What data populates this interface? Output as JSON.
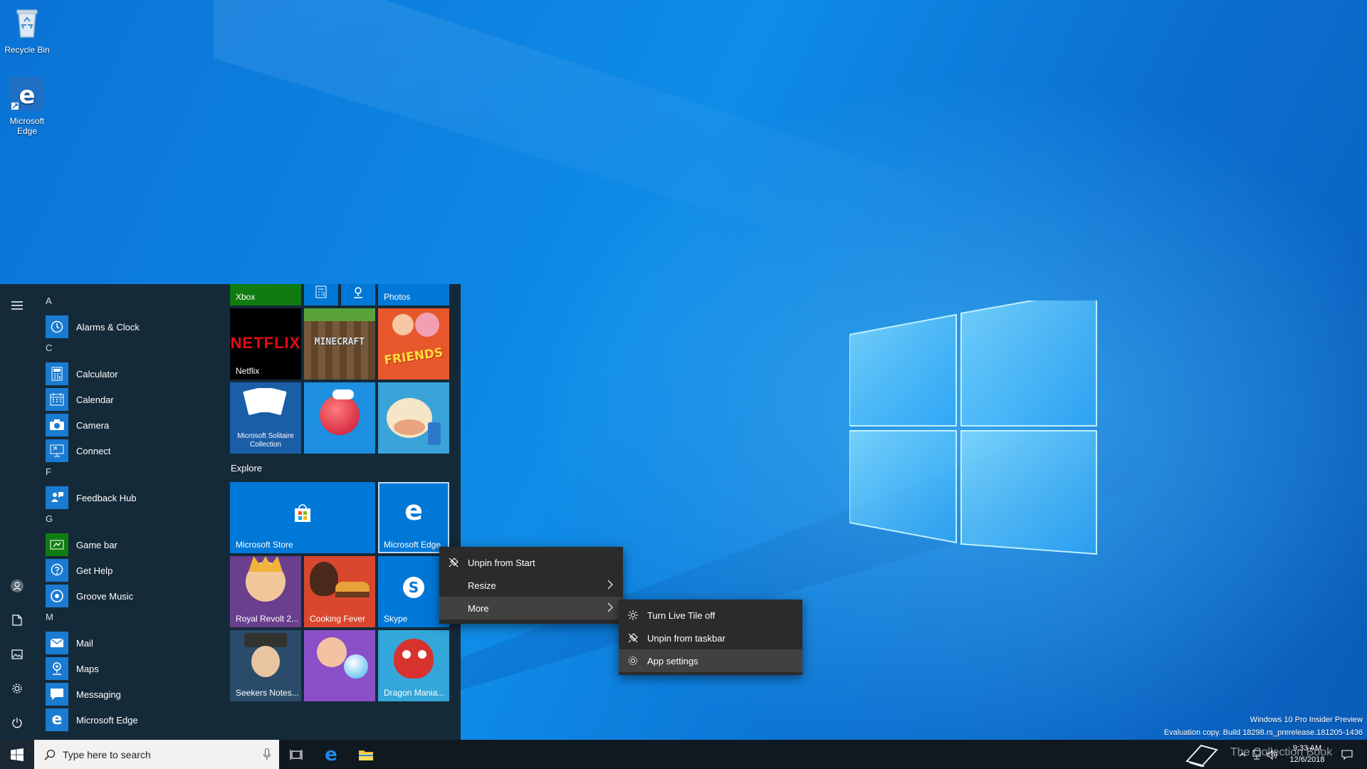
{
  "desktop": {
    "icons": [
      {
        "label": "Recycle Bin"
      },
      {
        "label": "Microsoft Edge"
      }
    ]
  },
  "start_menu": {
    "app_list": [
      {
        "type": "letter",
        "text": "A"
      },
      {
        "type": "app",
        "label": "Alarms & Clock",
        "icon": "alarm-clock-icon"
      },
      {
        "type": "letter",
        "text": "C"
      },
      {
        "type": "app",
        "label": "Calculator",
        "icon": "calculator-icon"
      },
      {
        "type": "app",
        "label": "Calendar",
        "icon": "calendar-icon"
      },
      {
        "type": "app",
        "label": "Camera",
        "icon": "camera-icon"
      },
      {
        "type": "app",
        "label": "Connect",
        "icon": "connect-icon"
      },
      {
        "type": "letter",
        "text": "F"
      },
      {
        "type": "app",
        "label": "Feedback Hub",
        "icon": "feedback-icon"
      },
      {
        "type": "letter",
        "text": "G"
      },
      {
        "type": "app",
        "label": "Game bar",
        "icon": "game-bar-icon"
      },
      {
        "type": "app",
        "label": "Get Help",
        "icon": "help-icon"
      },
      {
        "type": "app",
        "label": "Groove Music",
        "icon": "music-icon"
      },
      {
        "type": "letter",
        "text": "M"
      },
      {
        "type": "app",
        "label": "Mail",
        "icon": "mail-icon"
      },
      {
        "type": "app",
        "label": "Maps",
        "icon": "maps-icon"
      },
      {
        "type": "app",
        "label": "Messaging",
        "icon": "messaging-icon"
      },
      {
        "type": "app",
        "label": "Microsoft Edge",
        "icon": "edge-icon"
      }
    ],
    "rail_icons": [
      "hamburger-menu-icon",
      "user-icon",
      "documents-icon",
      "pictures-icon",
      "settings-icon",
      "power-icon"
    ],
    "tiles": {
      "xbox": "Xbox",
      "photos": "Photos",
      "netflix": "Netflix",
      "netflix_logo": "NETFLIX",
      "minecraft_logo": "MINECRAFT",
      "friends_logo": "FRIENDS",
      "solitaire": "Microsoft Solitaire Collection",
      "explore_group": "Explore",
      "store": "Microsoft Store",
      "edge": "Microsoft Edge",
      "royal_revolt": "Royal Revolt 2...",
      "cooking_fever": "Cooking Fever",
      "skype": "Skype",
      "seekers_notes": "Seekers Notes...",
      "dragon_mania": "Dragon Mania..."
    }
  },
  "context_menu": {
    "items": [
      {
        "label": "Unpin from Start",
        "icon": "unpin-icon"
      },
      {
        "label": "Resize",
        "icon": "",
        "submenu": true
      },
      {
        "label": "More",
        "icon": "",
        "submenu": true
      }
    ]
  },
  "submenu": {
    "items": [
      {
        "label": "Turn Live Tile off",
        "icon": "live-tile-icon"
      },
      {
        "label": "Unpin from taskbar",
        "icon": "unpin-icon"
      },
      {
        "label": "App settings",
        "icon": "gear-icon"
      }
    ]
  },
  "taskbar": {
    "search_placeholder": "Type here to search",
    "time": "9:33 AM",
    "date": "12/6/2018"
  },
  "watermark": {
    "line1": "Windows 10 Pro Insider Preview",
    "line2": "Evaluation copy. Build 18298.rs_prerelease.181205-1436",
    "brand": "The Collection Book"
  }
}
